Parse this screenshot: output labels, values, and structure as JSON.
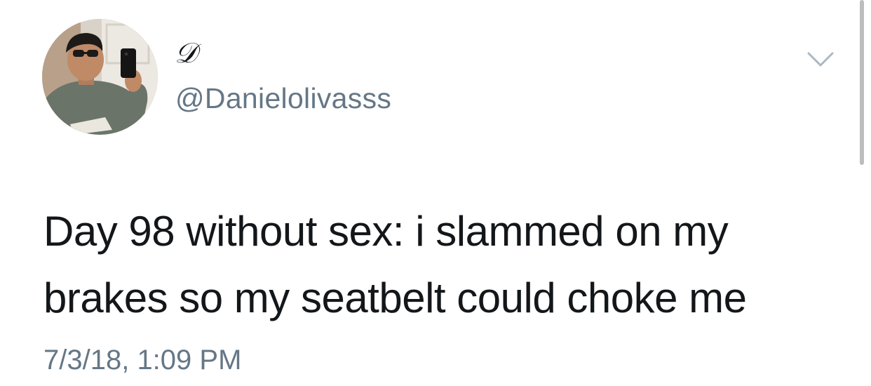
{
  "user": {
    "display_name": "𝒟",
    "handle": "@Danielolivasss",
    "avatar_icon": "profile-photo"
  },
  "tweet": {
    "text": "Day 98 without sex: i slammed on my\nbrakes so my seatbelt could choke me",
    "timestamp": "7/3/18, 1:09 PM"
  },
  "icons": {
    "menu": "chevron-down-icon"
  },
  "colors": {
    "text_primary": "#14171a",
    "text_secondary": "#657786",
    "chevron": "#aab8c2",
    "background": "#ffffff"
  }
}
